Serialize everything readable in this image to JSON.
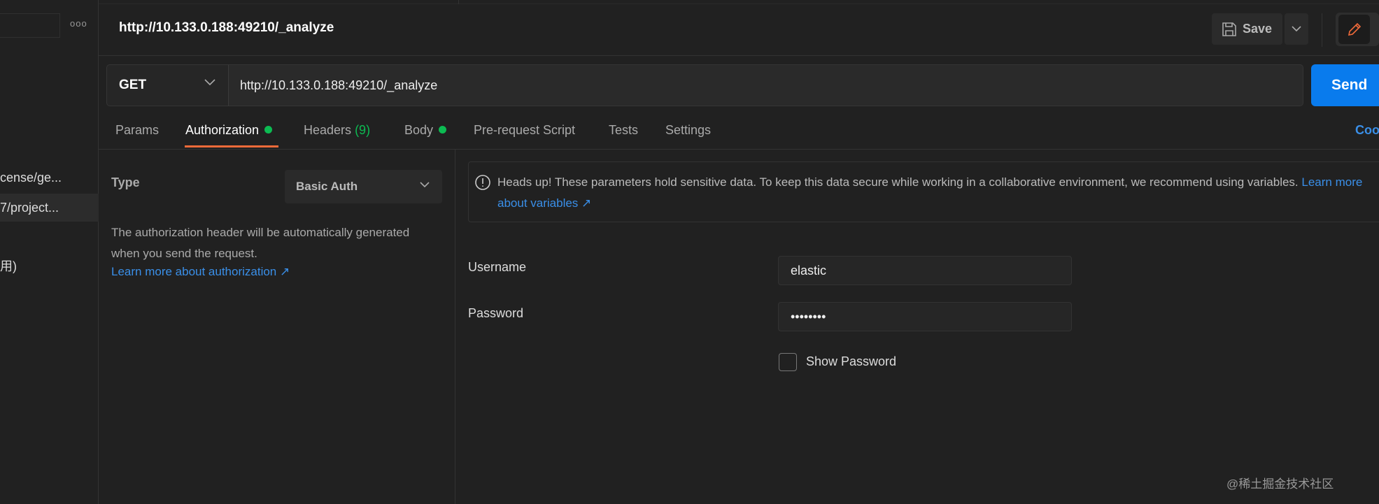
{
  "sidebar": {
    "more_label": "ooo",
    "items": [
      {
        "label": "cense/ge...",
        "selected": false
      },
      {
        "label": "7/project...",
        "selected": true
      },
      {
        "label": "用)",
        "selected": false
      }
    ]
  },
  "header": {
    "title": "http://10.133.0.188:49210/_analyze",
    "save_label": "Save"
  },
  "request": {
    "method": "GET",
    "url": "http://10.133.0.188:49210/_analyze",
    "send_label": "Send"
  },
  "tabs": {
    "params": "Params",
    "authorization": "Authorization",
    "headers": "Headers",
    "headers_count": "(9)",
    "body": "Body",
    "prerequest": "Pre-request Script",
    "tests": "Tests",
    "settings": "Settings",
    "cookies": "Coo",
    "active": "Authorization"
  },
  "auth": {
    "type_label": "Type",
    "type_value": "Basic Auth",
    "description": "The authorization header will be automatically generated when you send the request.",
    "learn_more": "Learn more about authorization ↗",
    "info_text": "Heads up! These parameters hold sensitive data. To keep this data secure while working in a collaborative environment, we recommend using variables.",
    "info_link": "Learn more about variables ↗",
    "username_label": "Username",
    "username_value": "elastic",
    "password_label": "Password",
    "password_value": "••••••••",
    "show_password_label": "Show Password",
    "show_password_checked": false
  },
  "watermark": "@稀土掘金技术社区",
  "colors": {
    "accent": "#f26b3a",
    "send": "#097bed",
    "link": "#3a8fe8",
    "dot": "#0cbb52",
    "bg": "#212121"
  }
}
